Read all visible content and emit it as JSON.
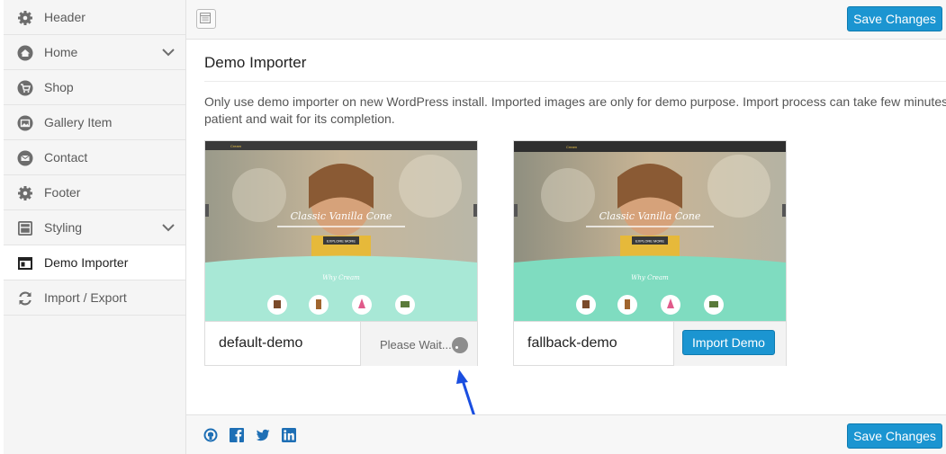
{
  "sidebar": {
    "items": [
      {
        "label": "Header",
        "icon": "gear-icon"
      },
      {
        "label": "Home",
        "icon": "home-icon"
      },
      {
        "label": "Shop",
        "icon": "shop-icon"
      },
      {
        "label": "Gallery Item",
        "icon": "gallery-icon"
      },
      {
        "label": "Contact",
        "icon": "contact-icon"
      },
      {
        "label": "Footer",
        "icon": "gear-icon"
      },
      {
        "label": "Styling",
        "icon": "styling-icon"
      },
      {
        "label": "Demo Importer",
        "icon": "demo-importer-icon",
        "active": true
      },
      {
        "label": "Import / Export",
        "icon": "refresh-icon"
      }
    ]
  },
  "toolbar": {
    "save_label": "Save Changes"
  },
  "main": {
    "title": "Demo Importer",
    "description": "Only use demo importer on new WordPress install. Imported images are only for demo purpose. Import process can take few minutes to complete, please be patient and wait for its completion.",
    "description_line1": "Only use demo importer on new WordPress install. Imported images are only for demo purpose. Import process can take few minutes to",
    "description_line2": "patient and wait for its completion.",
    "demos": [
      {
        "name": "default-demo",
        "status": "Please Wait...",
        "thumb_title": "Classic Vanilla Cone",
        "thumb_btn": "EXPLORE MORE",
        "thumb_section": "Why Cream"
      },
      {
        "name": "fallback-demo",
        "action_label": "Import Demo",
        "thumb_title": "Classic Vanilla Cone",
        "thumb_btn": "EXPLORE MORE",
        "thumb_section": "Why Cream"
      }
    ]
  },
  "footer": {
    "save_label": "Save Changes"
  },
  "colors": {
    "accent": "#1b95d1",
    "arrow": "#1a4ee0",
    "mint": "#a8e8d6"
  }
}
